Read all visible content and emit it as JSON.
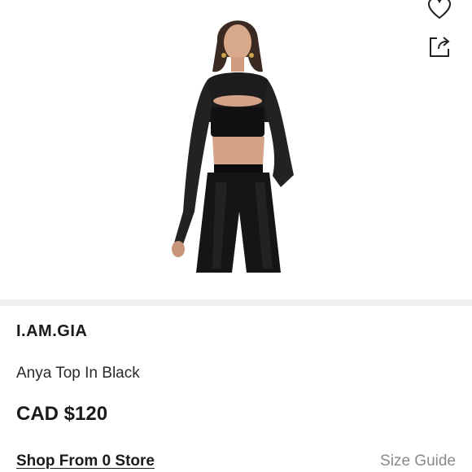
{
  "product": {
    "brand": "I.AM.GIA",
    "name": "Anya Top In Black",
    "price": "CAD $120"
  },
  "actions": {
    "shop_from_store": "Shop From 0 Store",
    "size_guide": "Size Guide"
  },
  "icons": {
    "wishlist": "heart-icon",
    "share": "share-icon"
  },
  "colors": {
    "text": "#1a1a1a",
    "muted": "#8a8a8a",
    "divider": "#efefef"
  }
}
